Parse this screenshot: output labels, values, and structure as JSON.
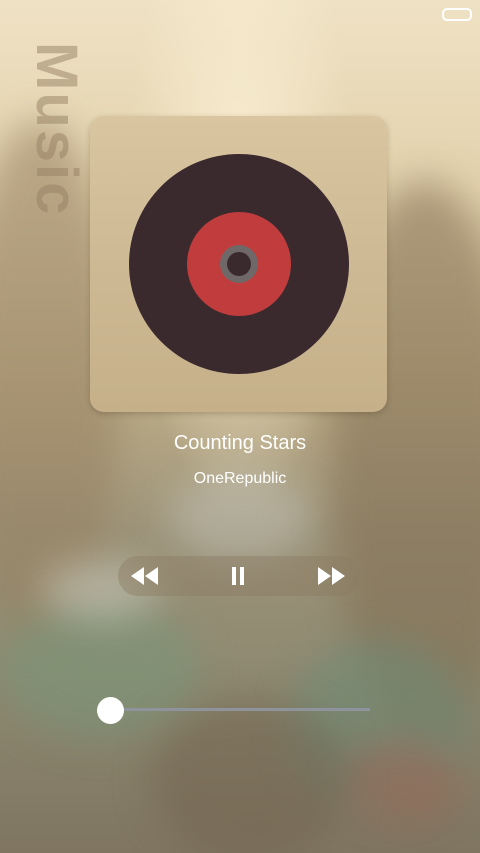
{
  "screen": {
    "side_title": "Music"
  },
  "now_playing": {
    "song_title": "Counting Stars",
    "artist": "OneRepublic"
  },
  "album_art": {
    "icon": "vinyl-record-icon",
    "colors": {
      "disc": "#3b2a2d",
      "label": "#c13d3d",
      "hub": "#6f6868"
    }
  },
  "controls": {
    "previous_icon": "rewind-icon",
    "pause_icon": "pause-icon",
    "next_icon": "fast-forward-icon"
  },
  "progress": {
    "fraction": 0.0
  },
  "status_bar": {
    "battery_icon": "battery-icon"
  }
}
